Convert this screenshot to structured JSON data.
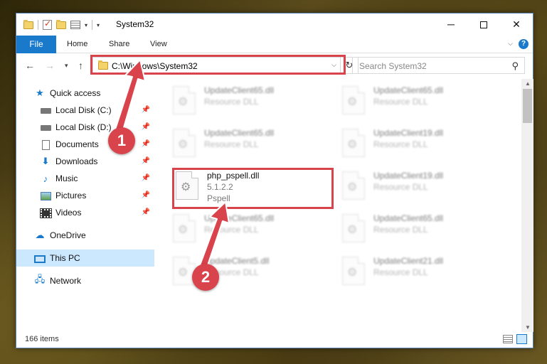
{
  "window": {
    "title": "System32"
  },
  "ribbon": {
    "file": "File",
    "home": "Home",
    "share": "Share",
    "view": "View"
  },
  "address": {
    "path": "C:\\Windows\\System32"
  },
  "search": {
    "placeholder": "Search System32"
  },
  "nav": {
    "quick_access": "Quick access",
    "items": [
      {
        "label": "Local Disk (C:)"
      },
      {
        "label": "Local Disk (D:)"
      },
      {
        "label": "Documents"
      },
      {
        "label": "Downloads"
      },
      {
        "label": "Music"
      },
      {
        "label": "Pictures"
      },
      {
        "label": "Videos"
      }
    ],
    "onedrive": "OneDrive",
    "this_pc": "This PC",
    "network": "Network"
  },
  "files": [
    {
      "name": "UpdateClient65.dll",
      "line2": "Resource DLL"
    },
    {
      "name": "UpdateClient65.dll",
      "line2": "Resource DLL"
    },
    {
      "name": "UpdateClient65.dll",
      "line2": "Resource DLL"
    },
    {
      "name": "UpdateClient19.dll",
      "line2": "Resource DLL"
    },
    {
      "name": "php_pspell.dll",
      "line2": "5.1.2.2",
      "line3": "Pspell"
    },
    {
      "name": "UpdateClient19.dll",
      "line2": "Resource DLL"
    },
    {
      "name": "UpdateClient65.dll",
      "line2": "Resource DLL"
    },
    {
      "name": "UpdateClient65.dll",
      "line2": "Resource DLL"
    },
    {
      "name": "UpdateClient5.dll",
      "line2": "Resource DLL"
    },
    {
      "name": "UpdateClient21.dll",
      "line2": "Resource DLL"
    }
  ],
  "status": {
    "count": "166 items"
  },
  "callouts": {
    "one": "1",
    "two": "2"
  },
  "colors": {
    "accent": "#1979ca",
    "highlight": "#d9434b",
    "selection": "#cce8ff"
  },
  "icons": {
    "folder": "folder-icon",
    "gear": "gear-icon",
    "search": "search-icon",
    "refresh": "refresh-icon",
    "pin": "pin-icon"
  }
}
